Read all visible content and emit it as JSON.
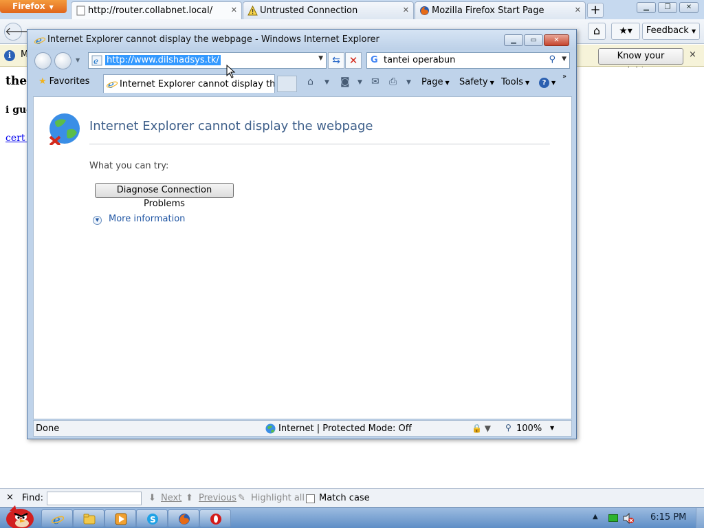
{
  "firefox": {
    "app_button": "Firefox",
    "tabs": [
      {
        "title": "http://router.collabnet.local/",
        "icon": "blank-page-icon",
        "active": true
      },
      {
        "title": "Untrusted Connection",
        "icon": "warning-icon",
        "active": false
      },
      {
        "title": "Mozilla Firefox Start Page",
        "icon": "firefox-icon",
        "active": false
      }
    ],
    "new_tab": "+",
    "window_controls": {
      "minimize": "▁",
      "maximize": "❐",
      "close": "✕"
    },
    "feedback_button": "Feedback",
    "notification": {
      "text": "M",
      "button": "Know your rights...",
      "close": "×"
    },
    "page": {
      "heading": "ther",
      "paragraph": "i gue",
      "link": "cert c"
    },
    "findbar": {
      "close": "×",
      "label": "Find:",
      "input_value": "",
      "next": "Next",
      "previous": "Previous",
      "highlight_all": "Highlight all",
      "match_case": "Match case"
    }
  },
  "ie": {
    "window_title": "Internet Explorer cannot display the webpage - Windows Internet Explorer",
    "address": "http://www.dilshadsys.tk/",
    "search_query": "tantei operabun",
    "favorites": "Favorites",
    "tab_title": "Internet Explorer cannot display the ...",
    "commands": {
      "page": "Page",
      "safety": "Safety",
      "tools": "Tools"
    },
    "error": {
      "title": "Internet Explorer cannot display the webpage",
      "what_you_can_try": "What you can try:",
      "diagnose_button": "Diagnose Connection Problems",
      "more_information": "More information"
    },
    "status": {
      "done": "Done",
      "zone": "Internet | Protected Mode: Off",
      "zoom": "100%"
    }
  },
  "taskbar": {
    "clock": "6:15 PM"
  },
  "colors": {
    "firefox_orange": "#e0661c",
    "ie_chrome": "#bfd3ea",
    "link_blue": "#1f55a3",
    "taskbar": "#5f8ec6"
  }
}
